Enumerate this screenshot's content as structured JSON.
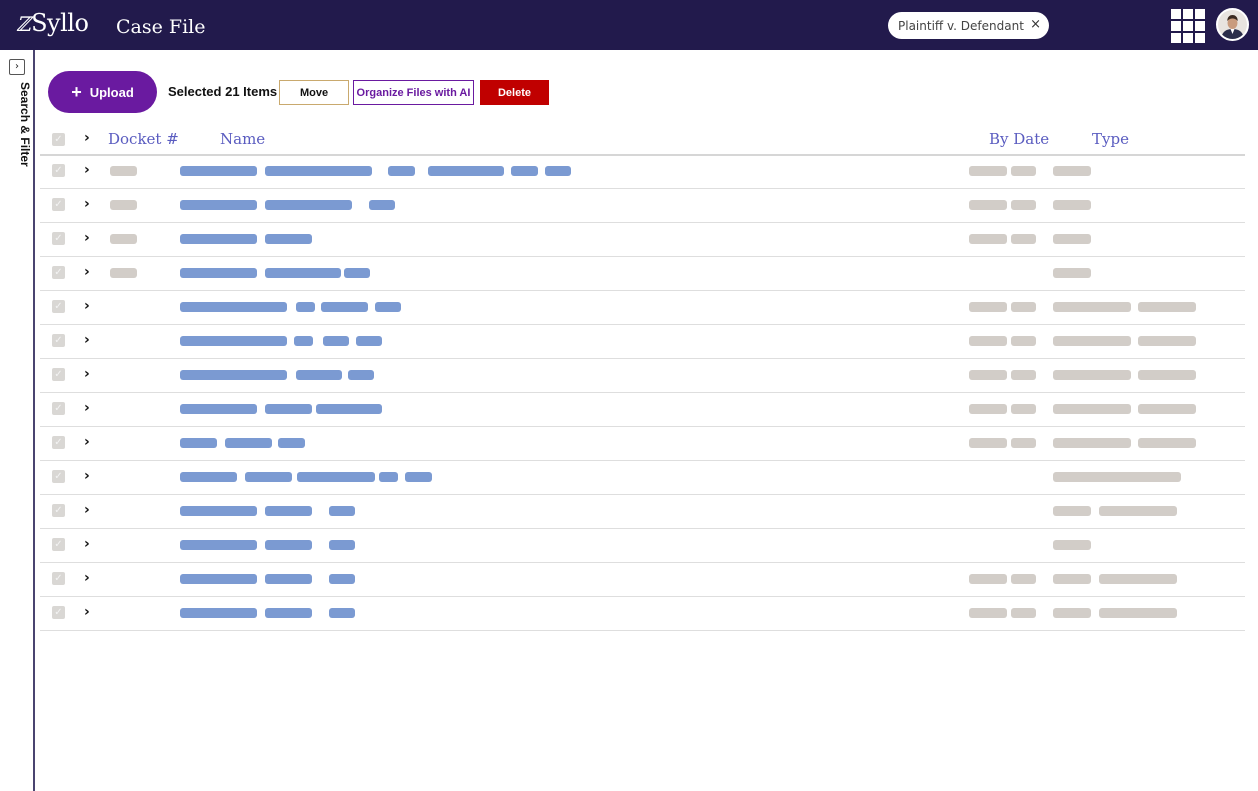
{
  "header": {
    "logo_mark": "ℤ",
    "logo_text": "Syllo",
    "title": "Case File",
    "case_chip": "Plaintiff v. Defendant",
    "chip_close": "×"
  },
  "sidebar": {
    "toggle": "›",
    "label": "Search & Filter"
  },
  "toolbar": {
    "upload_label": "Upload",
    "upload_plus": "+",
    "selected_text": "Selected 21 Items",
    "move_label": "Move",
    "ai_label": "Organize Files with AI",
    "delete_label": "Delete"
  },
  "table": {
    "columns": [
      "Docket #",
      "Name",
      "By Date",
      "Type"
    ],
    "row_count": 14
  },
  "colors": {
    "topbar": "#221a4c",
    "accent_purple": "#6a1aa0",
    "danger": "#c00000",
    "header_text": "#5a5cc0",
    "placeholder_blue": "#7b9ad2",
    "placeholder_gray": "#d2cdc8"
  }
}
